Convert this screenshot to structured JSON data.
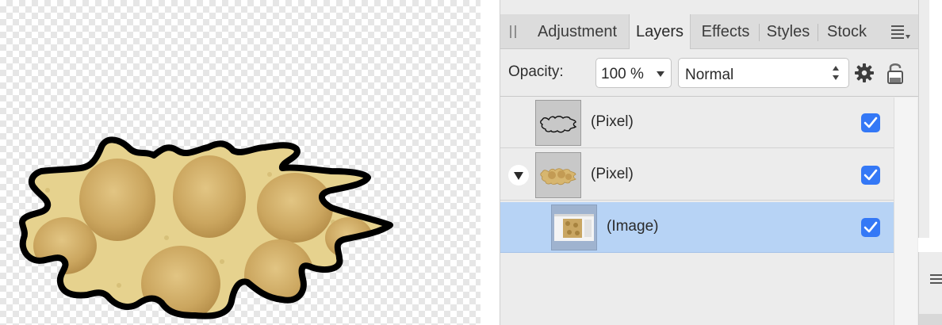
{
  "tabs": [
    {
      "label": "Adjustment",
      "active": false
    },
    {
      "label": "Layers",
      "active": true
    },
    {
      "label": "Effects",
      "active": false
    },
    {
      "label": "Styles",
      "active": false
    },
    {
      "label": "Stock",
      "active": false
    }
  ],
  "options": {
    "opacity_label": "Opacity:",
    "opacity_value": "100 %",
    "blend_mode": "Normal"
  },
  "layers": [
    {
      "name": "(Pixel)",
      "visible": true,
      "thumbnail": "outline-shape",
      "selected": false,
      "expanded": null
    },
    {
      "name": "(Pixel)",
      "visible": true,
      "thumbnail": "filled-shape",
      "selected": false,
      "expanded": true
    },
    {
      "name": "(Image)",
      "visible": true,
      "thumbnail": "image",
      "selected": true,
      "expanded": null
    }
  ],
  "colors": {
    "selection": "#b7d3f5",
    "checkbox": "#3478f6",
    "shape_fill": "#cfae6a",
    "shape_stroke": "#000000"
  },
  "icons": [
    "grip-icon",
    "panel-menu-icon",
    "chevron-down-icon",
    "stepper-icon",
    "gear-icon",
    "lock-icon",
    "checkbox-icon",
    "disclosure-triangle-icon"
  ]
}
